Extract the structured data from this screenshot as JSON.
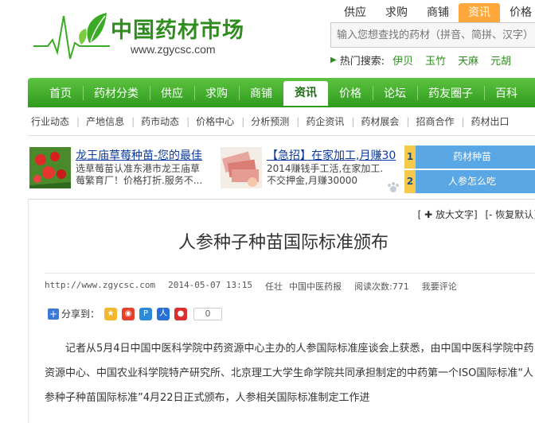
{
  "logo": {
    "name_cn": "中国药材市场",
    "url": "www.zgycsc.com"
  },
  "search": {
    "tabs": [
      "供应",
      "求购",
      "商铺",
      "资讯",
      "价格"
    ],
    "active_tab": "资讯",
    "placeholder": "输入您想查找的药材（拼音、简拼、汉字）",
    "hot_label": "热门搜索:",
    "hot_items": [
      "伊贝",
      "玉竹",
      "天麻",
      "元胡"
    ]
  },
  "nav": {
    "items": [
      "首页",
      "药材分类",
      "供应",
      "求购",
      "商铺",
      "资讯",
      "价格",
      "论坛",
      "药友圈子",
      "百科"
    ],
    "active": "资讯"
  },
  "subnav": [
    "行业动态",
    "产地信息",
    "药市动态",
    "价格中心",
    "分析预测",
    "药企资讯",
    "药材展会",
    "招商合作",
    "药材出口"
  ],
  "ads": [
    {
      "title": "龙王庙草莓种苗-您的最佳",
      "desc": "选草莓苗认准东港市龙王庙草莓繁育厂！价格打折.服务不..."
    },
    {
      "title": "【急招】在家加工,月赚30",
      "desc": "2014赚钱手工活,在家加工. 不交押金,月赚30000"
    }
  ],
  "rank": [
    {
      "num": "1",
      "label": "药材种苗"
    },
    {
      "num": "2",
      "label": "人参怎么吃"
    }
  ],
  "article": {
    "tools_enlarge": "[ ✚ 放大文字]",
    "tools_restore": "[- 恢复默认]",
    "title": "人参种子种苗国际标准颁布",
    "meta_url": "http://www.zgycsc.com",
    "meta_time": "2014-05-07 13:15",
    "meta_author": "任壮",
    "meta_source": "中国中医药报",
    "meta_reads": "阅读次数:771",
    "meta_comment": "我要评论",
    "share_label": "分享到：",
    "share_count": "0",
    "body": "记者从5月4日中国中医科学院中药资源中心主办的人参国际标准座谈会上获悉，由中国中医科学院中药资源中心、中国农业科学院特产研究所、北京理工大学生命学院共同承担制定的中药第一个ISO国际标准“人参种子种苗国际标准”4月22日正式颁布，人参相关国际标准制定工作进"
  },
  "colors": {
    "brand_green": "#2f8c1f",
    "nav_green": "#3aab25",
    "accent_orange": "#ffa73a",
    "rank_blue": "#5aa7e6"
  }
}
